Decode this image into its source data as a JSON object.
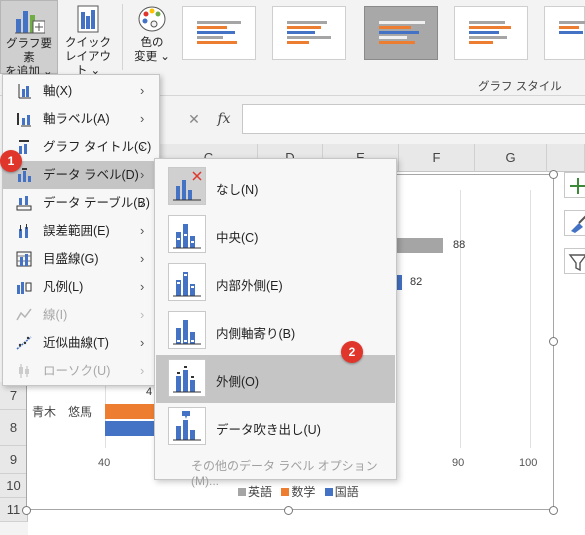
{
  "ribbon": {
    "add_element_label_1": "グラフ要素",
    "add_element_label_2": "を追加 ⌄",
    "quick_layout_label_1": "クイック",
    "quick_layout_label_2": "レイアウト ⌄",
    "change_color_label_1": "色の",
    "change_color_label_2": "変更 ⌄",
    "style_group_label": "グラフ スタイル"
  },
  "formula_bar": {
    "fx": "fx",
    "cancel": "✕",
    "enter": "✓"
  },
  "columns": [
    "C",
    "D",
    "E",
    "F",
    "G"
  ],
  "rows": [
    "7",
    "8",
    "9",
    "10",
    "11"
  ],
  "chart": {
    "row_label": "青木　悠馬",
    "x_ticks": [
      "40",
      "90",
      "100"
    ],
    "visible_values": [
      "88",
      "82",
      "4"
    ],
    "legend": [
      {
        "name": "英語",
        "color": "#a5a5a5"
      },
      {
        "name": "数学",
        "color": "#ed7d31"
      },
      {
        "name": "国語",
        "color": "#4472c4"
      }
    ]
  },
  "menu": {
    "items": [
      {
        "label": "軸(X)",
        "icon": "axis-icon",
        "disabled": false,
        "active": false
      },
      {
        "label": "軸ラベル(A)",
        "icon": "axis-label-icon",
        "disabled": false,
        "active": false
      },
      {
        "label": "グラフ タイトル(C)",
        "icon": "chart-title-icon",
        "disabled": false,
        "active": false
      },
      {
        "label": "データ ラベル(D)",
        "icon": "data-label-icon",
        "disabled": false,
        "active": true
      },
      {
        "label": "データ テーブル(B)",
        "icon": "data-table-icon",
        "disabled": false,
        "active": false
      },
      {
        "label": "誤差範囲(E)",
        "icon": "error-bars-icon",
        "disabled": false,
        "active": false
      },
      {
        "label": "目盛線(G)",
        "icon": "gridlines-icon",
        "disabled": false,
        "active": false
      },
      {
        "label": "凡例(L)",
        "icon": "legend-icon",
        "disabled": false,
        "active": false
      },
      {
        "label": "線(I)",
        "icon": "lines-icon",
        "disabled": true,
        "active": false
      },
      {
        "label": "近似曲線(T)",
        "icon": "trendline-icon",
        "disabled": false,
        "active": false
      },
      {
        "label": "ローソク(U)",
        "icon": "up-down-bars-icon",
        "disabled": true,
        "active": false
      }
    ]
  },
  "submenu": {
    "items": [
      {
        "label": "なし(N)",
        "active": false
      },
      {
        "label": "中央(C)",
        "active": false
      },
      {
        "label": "内部外側(E)",
        "active": false
      },
      {
        "label": "内側軸寄り(B)",
        "active": false
      },
      {
        "label": "外側(O)",
        "active": true
      },
      {
        "label": "データ吹き出し(U)",
        "active": false
      }
    ],
    "more_options": "その他のデータ ラベル オプション(M)..."
  },
  "badges": {
    "step1": "1",
    "step2": "2"
  },
  "colors": {
    "badge": "#e0352b",
    "blue": "#4472c4",
    "orange": "#ed7d31",
    "gray": "#a5a5a5"
  }
}
